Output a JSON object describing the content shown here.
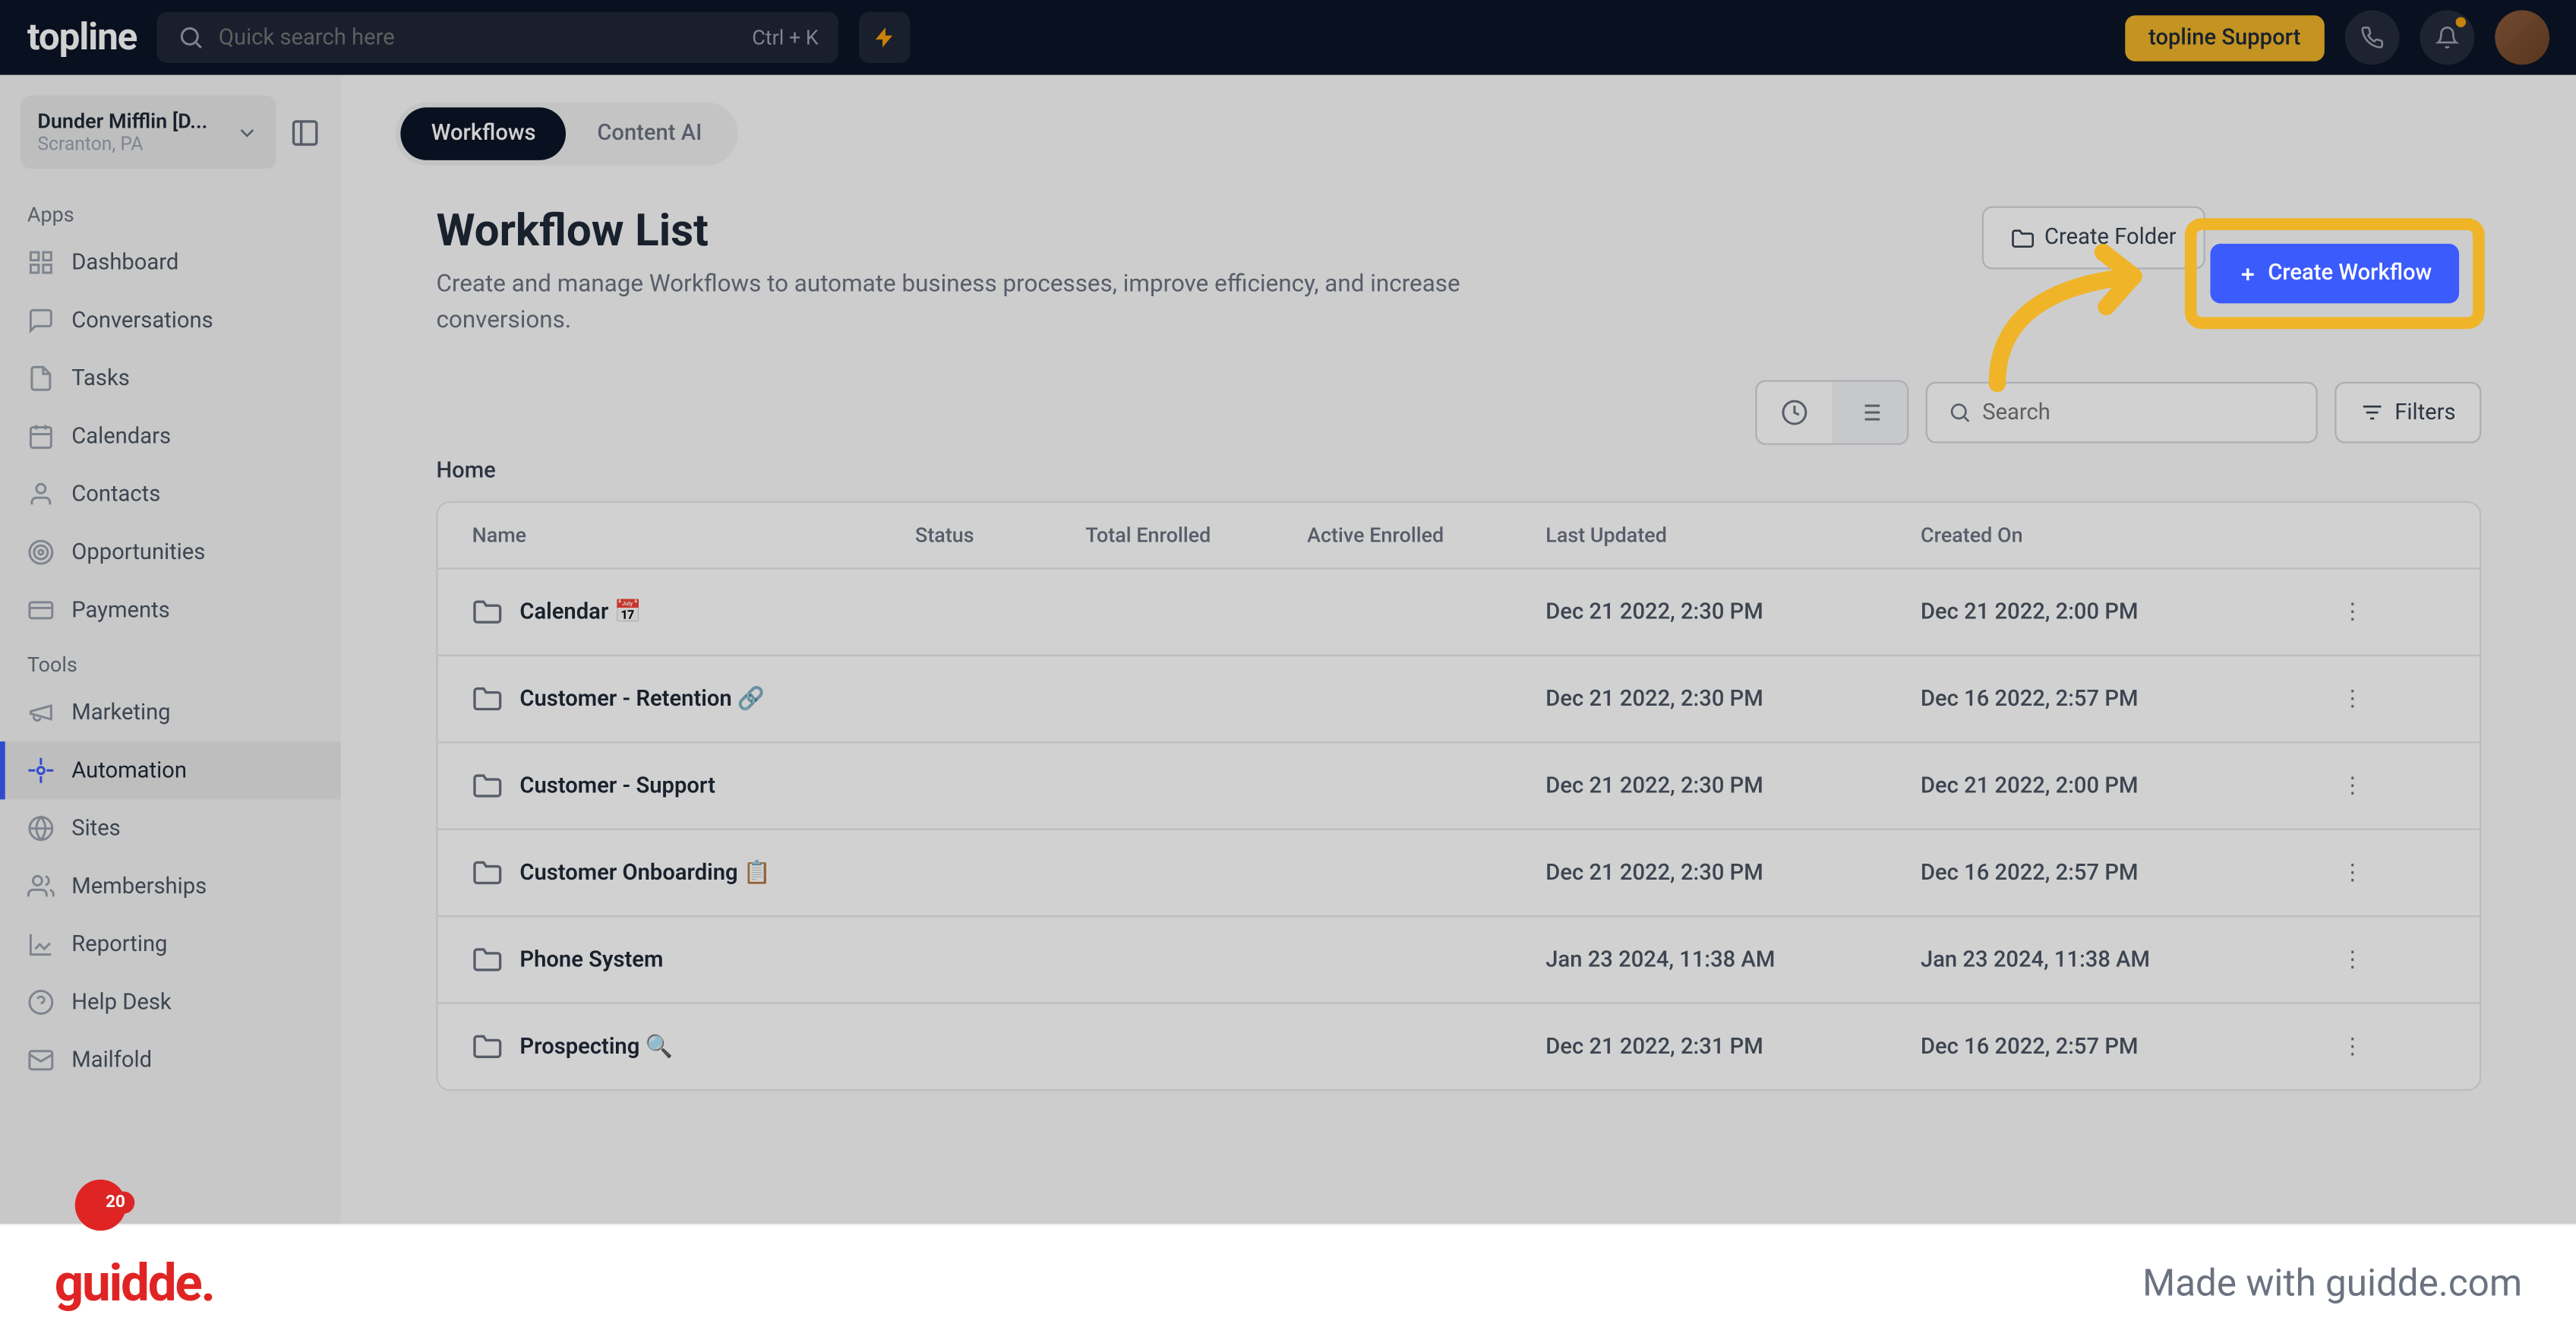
{
  "header": {
    "logo": "topline",
    "search_placeholder": "Quick search here",
    "shortcut": "Ctrl + K",
    "support_label": "topline Support"
  },
  "org": {
    "name": "Dunder Mifflin [D...",
    "location": "Scranton, PA"
  },
  "sidebar": {
    "apps_label": "Apps",
    "tools_label": "Tools",
    "apps": [
      {
        "label": "Dashboard"
      },
      {
        "label": "Conversations"
      },
      {
        "label": "Tasks"
      },
      {
        "label": "Calendars"
      },
      {
        "label": "Contacts"
      },
      {
        "label": "Opportunities"
      },
      {
        "label": "Payments"
      }
    ],
    "tools": [
      {
        "label": "Marketing"
      },
      {
        "label": "Automation"
      },
      {
        "label": "Sites"
      },
      {
        "label": "Memberships"
      },
      {
        "label": "Reporting"
      },
      {
        "label": "Help Desk"
      },
      {
        "label": "Mailfold"
      }
    ],
    "badge": "20"
  },
  "tabs": {
    "workflows": "Workflows",
    "content_ai": "Content AI"
  },
  "page": {
    "title": "Workflow List",
    "subtitle": "Create and manage Workflows to automate business processes, improve efficiency, and increase conversions.",
    "create_folder": "Create Folder",
    "create_workflow": "Create Workflow",
    "search_placeholder": "Search",
    "filters": "Filters",
    "breadcrumb": "Home"
  },
  "table": {
    "headers": {
      "name": "Name",
      "status": "Status",
      "total": "Total Enrolled",
      "active": "Active Enrolled",
      "updated": "Last Updated",
      "created": "Created On"
    },
    "rows": [
      {
        "name": "Calendar 📅",
        "updated": "Dec 21 2022, 2:30 PM",
        "created": "Dec 21 2022, 2:00 PM"
      },
      {
        "name": "Customer - Retention 🔗",
        "updated": "Dec 21 2022, 2:30 PM",
        "created": "Dec 16 2022, 2:57 PM"
      },
      {
        "name": "Customer - Support",
        "updated": "Dec 21 2022, 2:30 PM",
        "created": "Dec 21 2022, 2:00 PM"
      },
      {
        "name": "Customer Onboarding 📋",
        "updated": "Dec 21 2022, 2:30 PM",
        "created": "Dec 16 2022, 2:57 PM"
      },
      {
        "name": "Phone System",
        "updated": "Jan 23 2024, 11:38 AM",
        "created": "Jan 23 2024, 11:38 AM"
      },
      {
        "name": "Prospecting 🔍",
        "updated": "Dec 21 2022, 2:31 PM",
        "created": "Dec 16 2022, 2:57 PM"
      }
    ]
  },
  "footer": {
    "logo": "guidde.",
    "text": "Made with guidde.com"
  }
}
